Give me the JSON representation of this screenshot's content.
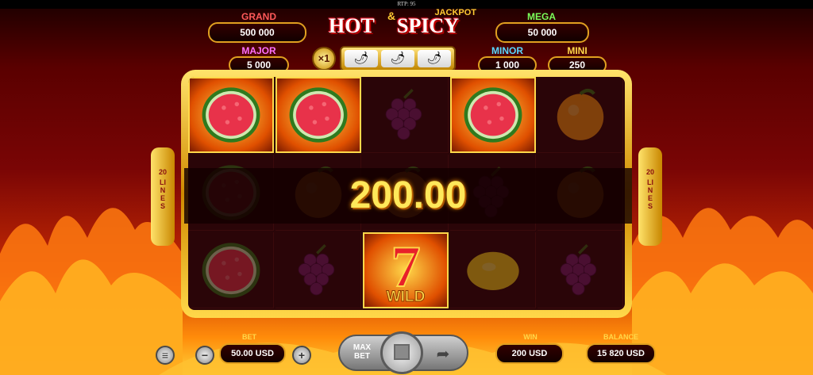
{
  "rtp": "RTP: 95",
  "title": {
    "hot": "HOT",
    "amp": "&",
    "spicy": "SPICY",
    "jackpot": "JACKPOT"
  },
  "jackpots": {
    "grand": {
      "label": "GRAND",
      "value": "500 000",
      "color": "#ff5a5a"
    },
    "major": {
      "label": "MAJOR",
      "value": "5 000",
      "color": "#ff70ff"
    },
    "mega": {
      "label": "MEGA",
      "value": "50 000",
      "color": "#7bff5a"
    },
    "minor": {
      "label": "MINOR",
      "value": "1 000",
      "color": "#5ad8ff"
    },
    "mini": {
      "label": "MINI",
      "value": "250",
      "color": "#ffd84a"
    }
  },
  "multiplier": "×1",
  "lines": {
    "count": "20",
    "word": "LINES"
  },
  "win_amount": "200.00",
  "wild_label": "WILD",
  "reels": [
    [
      "watermelon",
      "watermelon",
      "grapes",
      "watermelon",
      "orange"
    ],
    [
      "watermelon",
      "orange",
      "orange",
      "grapes",
      "orange"
    ],
    [
      "watermelon",
      "grapes",
      "wild-seven",
      "lemon",
      "grapes"
    ]
  ],
  "winning_cells": [
    [
      0,
      0
    ],
    [
      0,
      1
    ],
    [
      0,
      3
    ],
    [
      2,
      2
    ]
  ],
  "controls": {
    "bet_label": "BET",
    "bet_value": "50.00 USD",
    "max_bet_label": "MAX BET",
    "win_label": "WIN",
    "win_value": "200 USD",
    "balance_label": "BALANCE",
    "balance_value": "15 820 USD",
    "menu_icon": "menu-icon",
    "minus": "−",
    "plus": "+"
  }
}
